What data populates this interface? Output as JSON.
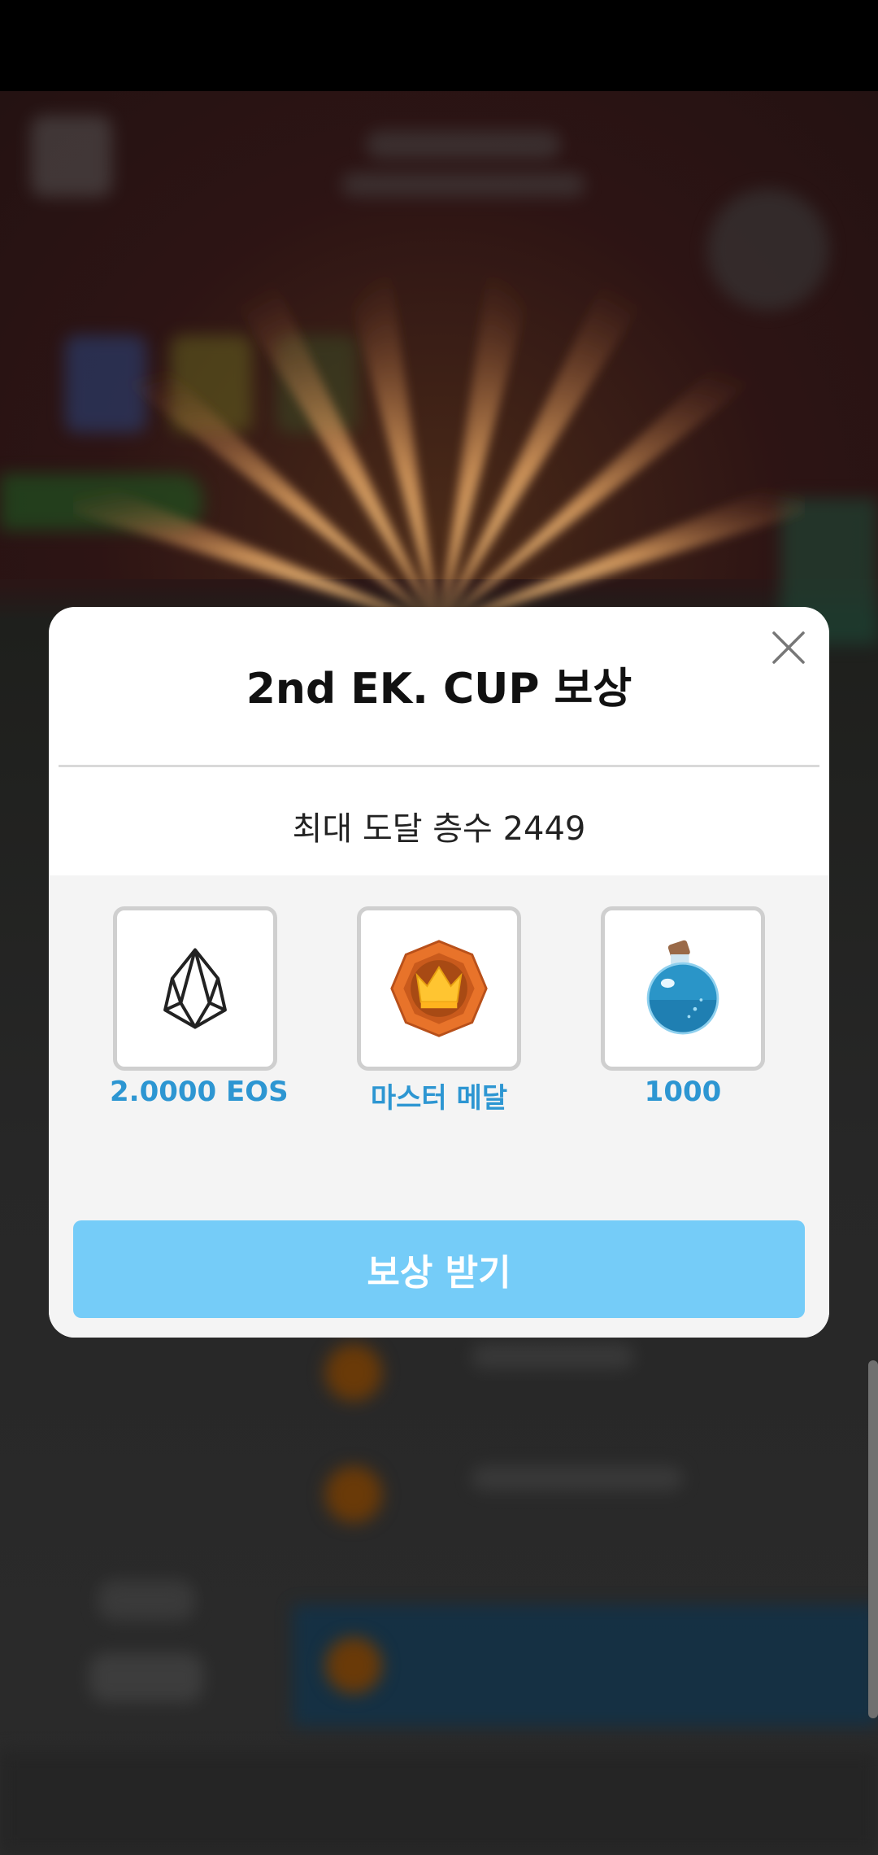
{
  "modal": {
    "title": "2nd EK. CUP 보상",
    "subtitle": "최대 도달 층수 2449",
    "rewards": [
      {
        "icon": "eos-icon",
        "label": "2.0000 EOS"
      },
      {
        "icon": "master-medal-icon",
        "label": "마스터 메달"
      },
      {
        "icon": "potion-icon",
        "label": "1000"
      }
    ],
    "claim_label": "보상 받기",
    "close_icon": "close-icon"
  },
  "colors": {
    "accent": "#2d96d2",
    "button": "#75ccf8",
    "modal_bg": "#ffffff",
    "reward_area_bg": "#f4f4f4"
  }
}
